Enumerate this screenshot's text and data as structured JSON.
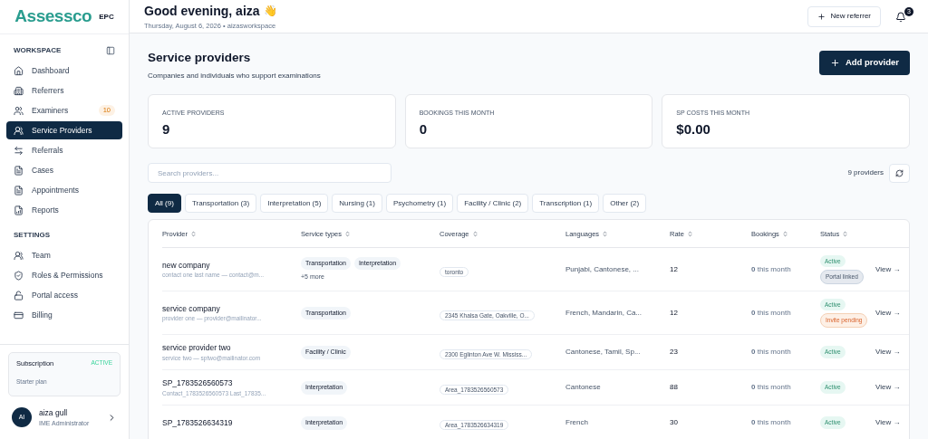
{
  "brand": {
    "logo": "Assessco",
    "tag": "EPC"
  },
  "sidebar": {
    "sections": [
      {
        "title": "WORKSPACE",
        "items": [
          {
            "label": "Dashboard",
            "selected": false
          },
          {
            "label": "Referrers",
            "selected": false
          },
          {
            "label": "Examiners",
            "selected": false,
            "badge": "10"
          },
          {
            "label": "Service Providers",
            "selected": true
          },
          {
            "label": "Referrals",
            "selected": false
          },
          {
            "label": "Cases",
            "selected": false
          },
          {
            "label": "Appointments",
            "selected": false
          },
          {
            "label": "Reports",
            "selected": false
          }
        ]
      },
      {
        "title": "SETTINGS",
        "items": [
          {
            "label": "Team",
            "selected": false
          },
          {
            "label": "Roles & Permissions",
            "selected": false
          },
          {
            "label": "Portal access",
            "selected": false
          },
          {
            "label": "Billing",
            "selected": false
          }
        ]
      }
    ],
    "subscription": {
      "title": "Subscription",
      "status": "ACTIVE",
      "plan": "Starter plan"
    },
    "user": {
      "initials": "AI",
      "name": "aiza gull",
      "role": "IME Administrator"
    }
  },
  "header": {
    "greeting": "Good evening, aiza",
    "emoji": "👋",
    "subtitle": "Thursday, August 6, 2026 • aizasworkspace",
    "new_button": "New referrer",
    "notifications": "3"
  },
  "page": {
    "title": "Service providers",
    "subtitle": "Companies and individuals who support examinations",
    "add_button": "Add provider"
  },
  "stats": [
    {
      "label": "ACTIVE PROVIDERS",
      "value": "9"
    },
    {
      "label": "BOOKINGS THIS MONTH",
      "value": "0"
    },
    {
      "label": "SP COSTS THIS MONTH",
      "value": "$0.00"
    }
  ],
  "search": {
    "placeholder": "Search providers..."
  },
  "count": "9 providers",
  "filters": [
    {
      "label": "All (9)",
      "selected": true
    },
    {
      "label": "Transportation (3)",
      "selected": false
    },
    {
      "label": "Interpretation (5)",
      "selected": false
    },
    {
      "label": "Nursing (1)",
      "selected": false
    },
    {
      "label": "Psychometry (1)",
      "selected": false
    },
    {
      "label": "Facility / Clinic (2)",
      "selected": false
    },
    {
      "label": "Transcription (1)",
      "selected": false
    },
    {
      "label": "Other (2)",
      "selected": false
    }
  ],
  "table": {
    "columns": [
      "Provider",
      "Service types",
      "Coverage",
      "Languages",
      "Rate",
      "Bookings",
      "Status"
    ],
    "rows": [
      {
        "name": "new company",
        "contact": "contact one last name — contact@m...",
        "types": [
          "Transportation",
          "Interpretation"
        ],
        "more": "+5 more",
        "coverage": "toronto",
        "languages": "Punjabi, Cantonese, ...",
        "rate": "12",
        "bookings": "**0** this month",
        "statuses": [
          {
            "label": "Active",
            "kind": "active"
          },
          {
            "label": "Portal linked",
            "kind": "linked"
          }
        ],
        "action": "View →"
      },
      {
        "name": "service company",
        "contact": "provider one — provider@mailinator...",
        "types": [
          "Transportation"
        ],
        "coverage": "2345 Khalsa Gate, Oakville, O...",
        "languages": "French, Mandarin, Ca...",
        "rate": "12",
        "bookings": "**0** this month",
        "statuses": [
          {
            "label": "Active",
            "kind": "active"
          },
          {
            "label": "Invite pending",
            "kind": "pending"
          }
        ],
        "action": "View →"
      },
      {
        "name": "service provider two",
        "contact": "service two — sptwo@mailinator.com",
        "types": [
          "Facility / Clinic"
        ],
        "coverage": "2300 Eglinton Ave W. Mississ...",
        "languages": "Cantonese, Tamil, Sp...",
        "rate": "23",
        "bookings": "**0** this month",
        "statuses": [
          {
            "label": "Active",
            "kind": "active"
          }
        ],
        "action": "View →"
      },
      {
        "name": "SP_1783526560573",
        "contact": "Contact_1783526560573 Last_17835...",
        "types": [
          "Interpretation"
        ],
        "coverage": "Area_1783526560573",
        "languages": "Cantonese",
        "rate": "88",
        "bookings": "**0** this month",
        "statuses": [
          {
            "label": "Active",
            "kind": "active"
          }
        ],
        "action": "View →"
      },
      {
        "name": "SP_1783526634319",
        "types": [
          "Interpretation"
        ],
        "coverage": "Area_1783526634319",
        "languages": "French",
        "rate": "30",
        "bookings": "**0** this month",
        "statuses": [
          {
            "label": "Active",
            "kind": "active"
          }
        ],
        "action": "View →"
      }
    ]
  }
}
